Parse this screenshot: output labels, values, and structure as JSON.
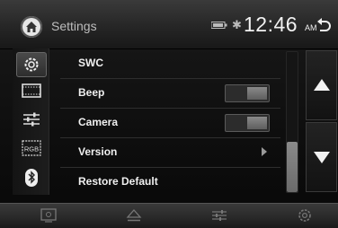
{
  "header": {
    "title": "Settings",
    "time": "12:46",
    "ampm": "AM"
  },
  "sidebar": {
    "items": [
      {
        "icon": "gear-icon",
        "active": true
      },
      {
        "icon": "display-icon",
        "active": false
      },
      {
        "icon": "sliders-icon",
        "active": false
      },
      {
        "icon": "rgb-icon",
        "label": "RGB",
        "active": false
      },
      {
        "icon": "bluetooth-icon",
        "active": false
      }
    ]
  },
  "settings": {
    "rows": [
      {
        "label": "SWC",
        "control": "none"
      },
      {
        "label": "Beep",
        "control": "toggle",
        "value": "on"
      },
      {
        "label": "Camera",
        "control": "toggle",
        "value": "on"
      },
      {
        "label": "Version",
        "control": "chevron"
      },
      {
        "label": "Restore Default",
        "control": "none"
      }
    ]
  },
  "scroll": {
    "position": "bottom"
  },
  "colors": {
    "accent": "#f0f0f0",
    "toggle_knob": "#7a7a7a",
    "background": "#0e0e0e"
  }
}
